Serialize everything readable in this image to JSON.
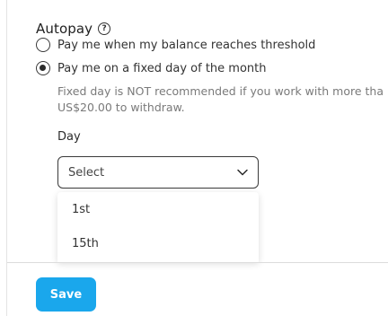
{
  "autopay": {
    "title": "Autopay",
    "help_glyph": "?",
    "options": [
      {
        "label": "Pay me when my balance reaches threshold",
        "selected": false
      },
      {
        "label": "Pay me on a fixed day of the month",
        "selected": true
      }
    ],
    "hint_line1": "Fixed day is NOT recommended if you work with more tha",
    "hint_line2": "US$20.00 to withdraw."
  },
  "day_field": {
    "label": "Day",
    "value": "Select",
    "options": [
      "1st",
      "15th"
    ]
  },
  "actions": {
    "save_label": "Save"
  },
  "colors": {
    "accent": "#1aa7ec",
    "text": "#2b2b2b",
    "hint": "#7a7a7a"
  }
}
